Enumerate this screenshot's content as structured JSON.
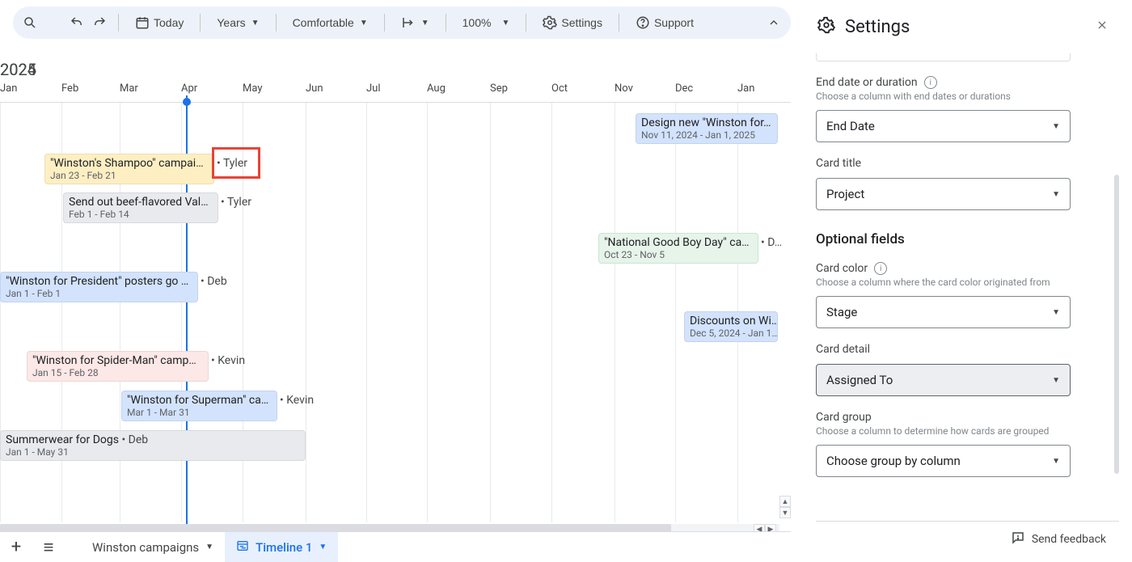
{
  "toolbar": {
    "today_label": "Today",
    "view_mode": "Years",
    "density": "Comfortable",
    "zoom": "100%",
    "settings": "Settings",
    "support": "Support"
  },
  "timeline": {
    "year_left": "2024",
    "year_right": "2025",
    "months": [
      "Jan",
      "Feb",
      "Mar",
      "Apr",
      "May",
      "Jun",
      "Jul",
      "Aug",
      "Sep",
      "Oct",
      "Nov",
      "Dec",
      "Jan"
    ]
  },
  "cards": {
    "c1": {
      "title": "Design new \"Winston for…",
      "dates": "Nov 11, 2024 - Jan 1, 2025",
      "assignee": ""
    },
    "c2": {
      "title": "\"Winston's Shampoo\" campai…",
      "dates": "Jan 23 - Feb 21",
      "assignee": "Tyler"
    },
    "c3": {
      "title": "Send out beef-flavored Val…",
      "dates": "Feb 1 - Feb 14",
      "assignee": "Tyler"
    },
    "c4": {
      "title": "\"National Good Boy Day\" ca…",
      "dates": "Oct 23 - Nov 5",
      "assignee": "D…"
    },
    "c5": {
      "title": "\"Winston for President\" posters go …",
      "dates": "Jan 1 - Feb 1",
      "assignee": "Deb"
    },
    "c6": {
      "title": "Discounts on Wi…",
      "dates": "Dec 5, 2024 - Jan 1…",
      "assignee": ""
    },
    "c7": {
      "title": "\"Winston for Spider-Man\" camp…",
      "dates": "Jan 15 - Feb 28",
      "assignee": "Kevin"
    },
    "c8": {
      "title": "\"Winston for Superman\" ca…",
      "dates": "Mar 1 - Mar 31",
      "assignee": "Kevin"
    },
    "c9": {
      "title": "Summerwear for Dogs",
      "dates": "Jan 1 - May 31",
      "assignee": "Deb"
    }
  },
  "tabs": {
    "sheet1": "Winston campaigns",
    "sheet2": "Timeline 1"
  },
  "panel": {
    "title": "Settings",
    "end_date": {
      "label": "End date or duration",
      "help": "Choose a column with end dates or durations",
      "value": "End Date"
    },
    "card_title": {
      "label": "Card title",
      "value": "Project"
    },
    "optional_title": "Optional fields",
    "card_color": {
      "label": "Card color",
      "help": "Choose a column where the card color originated from",
      "value": "Stage"
    },
    "card_detail": {
      "label": "Card detail",
      "value": "Assigned To"
    },
    "card_group": {
      "label": "Card group",
      "help": "Choose a column to determine how cards are grouped",
      "value": "Choose group by column"
    },
    "feedback": "Send feedback"
  }
}
